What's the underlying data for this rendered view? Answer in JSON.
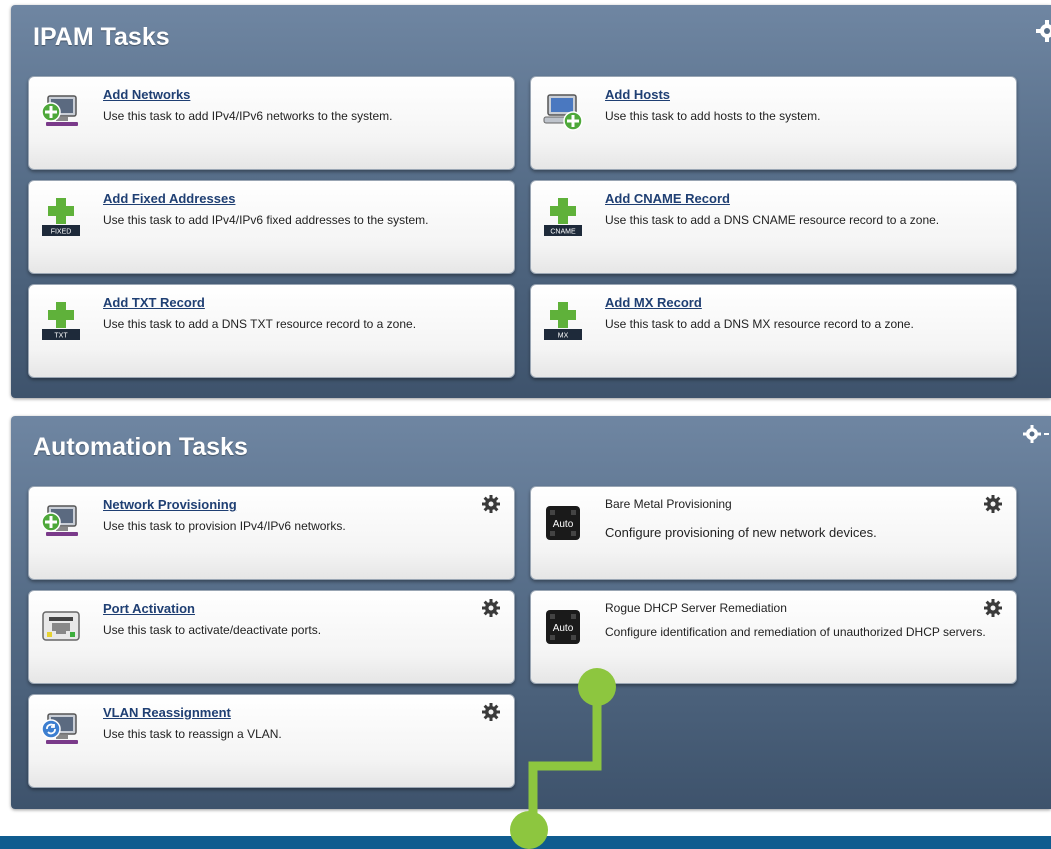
{
  "ipam": {
    "title": "IPAM Tasks",
    "cards": [
      {
        "title": "Add Networks",
        "desc": "Use this task to add IPv4/IPv6 networks to the system.",
        "icon": "add-network-icon"
      },
      {
        "title": "Add Hosts",
        "desc": "Use this task to add hosts to the system.",
        "icon": "add-host-icon"
      },
      {
        "title": "Add Fixed Addresses",
        "desc": "Use this task to add IPv4/IPv6 fixed addresses to the system.",
        "icon": "add-fixed-address-icon",
        "badge": "FIXED"
      },
      {
        "title": "Add CNAME Record",
        "desc": "Use this task to add a DNS CNAME resource record to a zone.",
        "icon": "add-cname-icon",
        "badge": "CNAME"
      },
      {
        "title": "Add TXT Record",
        "desc": "Use this task to add a DNS TXT resource record to a zone.",
        "icon": "add-txt-icon",
        "badge": "TXT"
      },
      {
        "title": "Add MX Record",
        "desc": "Use this task to add a DNS MX resource record to a zone.",
        "icon": "add-mx-icon",
        "badge": "MX"
      }
    ]
  },
  "automation": {
    "title": "Automation Tasks",
    "cards": [
      {
        "title": "Network Provisioning",
        "desc": "Use this task to provision IPv4/IPv6 networks.",
        "icon": "network-provisioning-icon"
      },
      {
        "title": "Bare Metal Provisioning",
        "desc": "Configure provisioning of new network devices.",
        "icon": "auto-icon",
        "badge": "Auto"
      },
      {
        "title": "Port Activation",
        "desc": "Use this task to activate/deactivate ports.",
        "icon": "port-activation-icon"
      },
      {
        "title": "Rogue DHCP Server Remediation",
        "desc": "Configure identification and remediation of unauthorized DHCP servers.",
        "icon": "auto-icon",
        "badge": "Auto"
      },
      {
        "title": "VLAN Reassignment",
        "desc": "Use this task to reassign a VLAN.",
        "icon": "vlan-reassignment-icon"
      }
    ]
  },
  "colors": {
    "panel": "#566d88",
    "link": "#1f3f73",
    "plus": "#5fb13a",
    "connector": "#8dc63f",
    "bottom_bar": "#0f5c8f"
  }
}
